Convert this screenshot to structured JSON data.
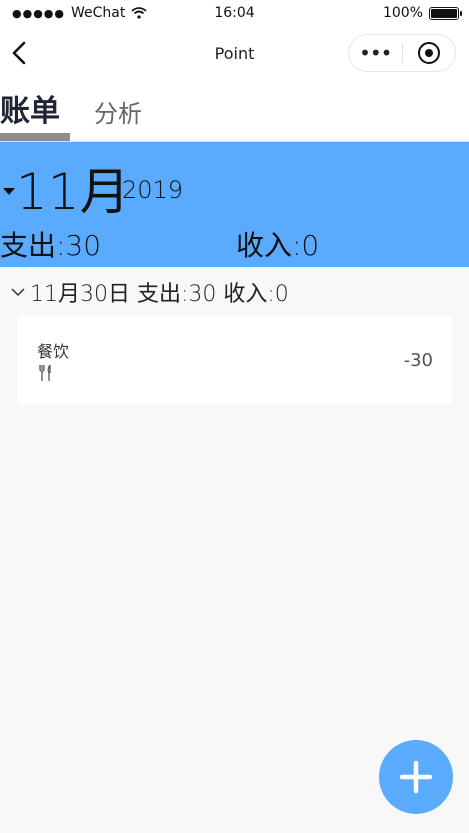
{
  "status_bar": {
    "carrier": "WeChat",
    "time": "16:04",
    "battery": "100%"
  },
  "nav": {
    "title": "Point"
  },
  "tabs": [
    {
      "label": "账单"
    },
    {
      "label": "分析"
    }
  ],
  "summary": {
    "month": "11月",
    "year": "2019",
    "expense": "支出:30",
    "income": "收入:0"
  },
  "day_group": {
    "header": "11月30日 支出:30 收入:0"
  },
  "records": [
    {
      "category": "餐饮",
      "icon": "fork-knife-icon",
      "amount": "-30"
    }
  ],
  "colors": {
    "accent": "#5aabfe",
    "tab_indicator": "#8e8e8e"
  }
}
